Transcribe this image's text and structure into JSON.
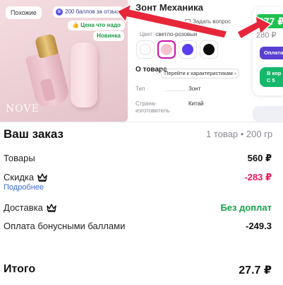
{
  "product": {
    "title": "Зонт Механика",
    "ask_question": "Задать вопрос",
    "color_label": "Цвет:",
    "color_value": "светло-розовый",
    "swatch_colors": [
      "#ffffff",
      "#f3c3cf",
      "#5b3df0",
      "#0b0b0b"
    ],
    "about_title": "О товаре",
    "about_link": "Перейти к характеристикам",
    "specs": [
      {
        "label": "Тип",
        "value": "Зонт"
      },
      {
        "label": "Страна-изготовитель",
        "value": "Китай"
      }
    ]
  },
  "gallery": {
    "similar_chip": "Похожие",
    "points_chip": "200 баллов за отзыв",
    "points_icon": "b",
    "price_chip": "Цена что надо",
    "new_chip": "Новинка",
    "brand_text": "NOVE"
  },
  "price_panel": {
    "price_now": "277 ₽",
    "price_old": "280 ₽",
    "pay_chip": "Оплатите",
    "cart_button_top": "В кор",
    "cart_button_bottom": "С 5"
  },
  "order": {
    "title": "Ваш заказ",
    "meta": "1 товар • 200 гр",
    "rows": [
      {
        "label": "Товары",
        "value": "560 ₽"
      },
      {
        "label": "Скидка",
        "value": "-283 ₽"
      },
      {
        "label": "Доставка",
        "value": "Без доплат"
      },
      {
        "label": "Оплата бонусными баллами",
        "value": "-249.3"
      }
    ],
    "more_link": "Подробнее",
    "total_label": "Итого",
    "total_value": "27.7 ₽"
  },
  "colors": {
    "accent_pink": "#cb11ab",
    "discount_red": "#f0155a",
    "delivery_green": "#16a34a",
    "price_green": "#1ec24f",
    "annotation_red": "#e8263a"
  }
}
